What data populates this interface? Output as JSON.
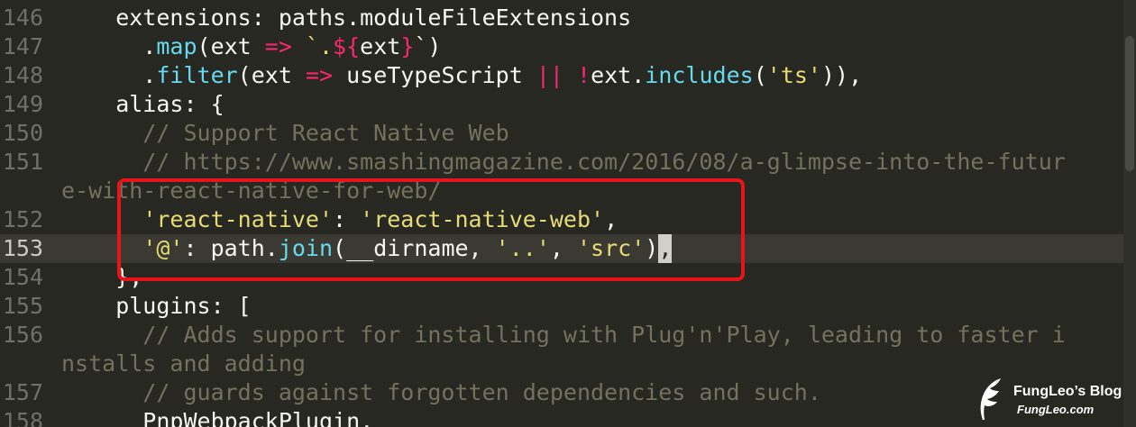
{
  "editor": {
    "lines": [
      {
        "num": "146",
        "segments": [
          {
            "t": "    extensions: paths.moduleFileExtensions",
            "c": "plain"
          }
        ]
      },
      {
        "num": "147",
        "segments": [
          {
            "t": "      .",
            "c": "plain"
          },
          {
            "t": "map",
            "c": "fn"
          },
          {
            "t": "(ext ",
            "c": "plain"
          },
          {
            "t": "=>",
            "c": "kw"
          },
          {
            "t": " `.",
            "c": "str"
          },
          {
            "t": "${",
            "c": "tpl"
          },
          {
            "t": "ext",
            "c": "plain"
          },
          {
            "t": "}",
            "c": "tpl"
          },
          {
            "t": "`)",
            "c": "plain"
          }
        ]
      },
      {
        "num": "148",
        "segments": [
          {
            "t": "      .",
            "c": "plain"
          },
          {
            "t": "filter",
            "c": "fn"
          },
          {
            "t": "(ext ",
            "c": "plain"
          },
          {
            "t": "=>",
            "c": "kw"
          },
          {
            "t": " useTypeScript ",
            "c": "plain"
          },
          {
            "t": "||",
            "c": "kw"
          },
          {
            "t": " ",
            "c": "plain"
          },
          {
            "t": "!",
            "c": "kw"
          },
          {
            "t": "ext.",
            "c": "plain"
          },
          {
            "t": "includes",
            "c": "fn"
          },
          {
            "t": "(",
            "c": "plain"
          },
          {
            "t": "'ts'",
            "c": "str"
          },
          {
            "t": ")),",
            "c": "plain"
          }
        ]
      },
      {
        "num": "149",
        "segments": [
          {
            "t": "    alias: {",
            "c": "plain"
          }
        ]
      },
      {
        "num": "150",
        "segments": [
          {
            "t": "      // Support React Native Web",
            "c": "cmt"
          }
        ]
      },
      {
        "num": "151",
        "segments": [
          {
            "t": "      // https://www.smashingmagazine.com/2016/08/a-glimpse-into-the-futur",
            "c": "cmt"
          }
        ]
      },
      {
        "num": "",
        "segments": [
          {
            "t": "e-with-react-native-for-web/",
            "c": "cmt"
          }
        ]
      },
      {
        "num": "152",
        "segments": [
          {
            "t": "      ",
            "c": "plain"
          },
          {
            "t": "'react-native'",
            "c": "str"
          },
          {
            "t": ": ",
            "c": "plain"
          },
          {
            "t": "'react-native-web'",
            "c": "str"
          },
          {
            "t": ",",
            "c": "plain"
          }
        ]
      },
      {
        "num": "153",
        "current": true,
        "segments": [
          {
            "t": "      ",
            "c": "plain"
          },
          {
            "t": "'@'",
            "c": "str"
          },
          {
            "t": ": path.",
            "c": "plain"
          },
          {
            "t": "join",
            "c": "fn"
          },
          {
            "t": "(__dirname, ",
            "c": "plain"
          },
          {
            "t": "'..'",
            "c": "str"
          },
          {
            "t": ", ",
            "c": "plain"
          },
          {
            "t": "'src'",
            "c": "str"
          },
          {
            "t": ")",
            "c": "plain"
          },
          {
            "t": ",",
            "c": "cursor"
          }
        ]
      },
      {
        "num": "154",
        "segments": [
          {
            "t": "    },",
            "c": "plain"
          }
        ]
      },
      {
        "num": "155",
        "segments": [
          {
            "t": "    plugins: [",
            "c": "plain"
          }
        ]
      },
      {
        "num": "156",
        "segments": [
          {
            "t": "      // Adds support for installing with Plug'n'Play, leading to faster i",
            "c": "cmt"
          }
        ]
      },
      {
        "num": "",
        "segments": [
          {
            "t": "nstalls and adding",
            "c": "cmt"
          }
        ]
      },
      {
        "num": "157",
        "segments": [
          {
            "t": "      // guards against forgotten dependencies and such.",
            "c": "cmt"
          }
        ]
      },
      {
        "num": "158",
        "segments": [
          {
            "t": "      PnpWebpackPlugin,",
            "c": "plain"
          }
        ]
      }
    ]
  },
  "watermark": {
    "title": "FungLeo’s Blog",
    "subtitle": "FungLeo.com",
    "icon": "feather-icon"
  },
  "colors": {
    "background": "#272822",
    "highlight_box": "#e8141b",
    "string": "#e6db74",
    "keyword": "#f92672",
    "function": "#66d9ef",
    "comment": "#75715e"
  }
}
